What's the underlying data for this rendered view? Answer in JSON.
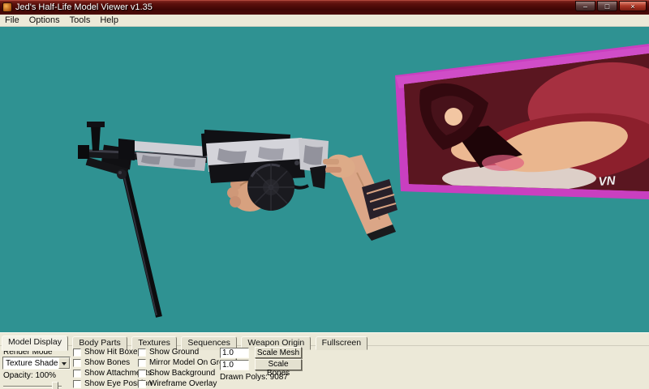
{
  "window": {
    "title": "Jed's Half-Life Model Viewer v1.35",
    "buttons": {
      "minimize": "–",
      "maximize": "□",
      "close": "×"
    }
  },
  "menu": {
    "items": [
      "File",
      "Options",
      "Tools",
      "Help"
    ]
  },
  "tabs": [
    "Model Display",
    "Body Parts",
    "Textures",
    "Sequences",
    "Weapon Origin",
    "Fullscreen"
  ],
  "controls": {
    "render_mode_label": "Render Mode",
    "render_mode_value": "Texture Shaded",
    "opacity_label": "Opacity: 100%",
    "checkbox_col1": [
      "Show Hit Boxes",
      "Show Bones",
      "Show Attachments",
      "Show Eye Position"
    ],
    "checkbox_col2": [
      "Show Ground",
      "Mirror Model On Ground",
      "Show Background",
      "Wireframe Overlay"
    ],
    "scale_mesh_value": "1.0",
    "scale_mesh_button": "Scale Mesh",
    "scale_bones_value": "1.0",
    "scale_bones_button": "Scale Bones",
    "drawn_polys": "Drawn Polys: 9087"
  },
  "viewport": {
    "model_name": "AK-47 with drum magazine view model",
    "billboard_watermark": "VN",
    "colors": {
      "background": "#2f9292",
      "billboard_border": "#c93fc0",
      "titlebar": "#4c0b08",
      "panel": "#ece9d8"
    }
  }
}
